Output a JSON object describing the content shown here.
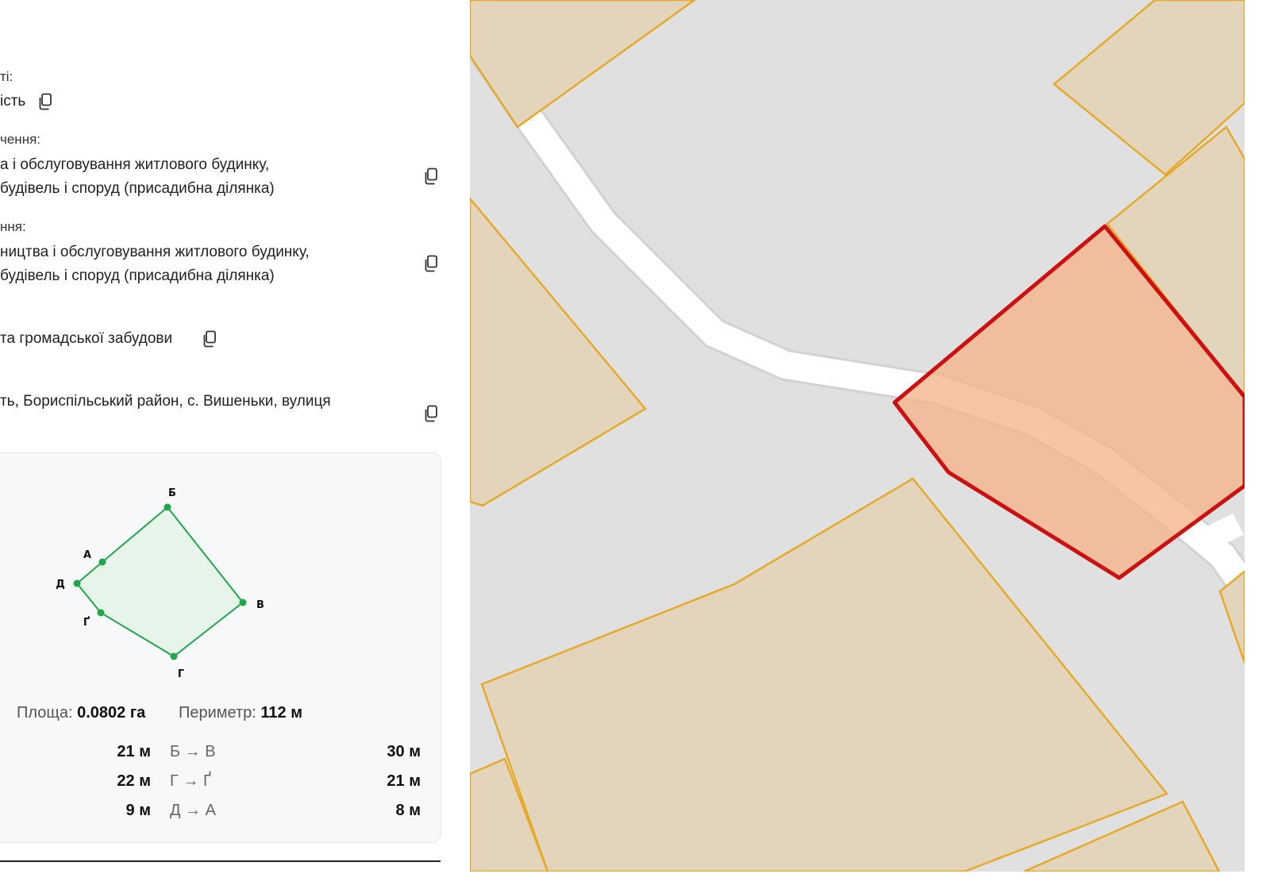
{
  "panel": {
    "ownership": {
      "label": "ті:",
      "value": "ість"
    },
    "purpose": {
      "label": "чення:",
      "line1": "а і обслуговування житлового будинку,",
      "line2": "будівель і споруд (присадибна ділянка)"
    },
    "usage": {
      "label": "ння:",
      "line1": "ництва і обслуговування житлового будинку,",
      "line2": "будівель і споруд (присадибна ділянка)"
    },
    "category": {
      "value": "та громадської забудови"
    },
    "address": {
      "line1": "ть, Бориспільський район, с. Вишеньки, вулиця"
    }
  },
  "shape_card": {
    "vertices": [
      "Б",
      "А",
      "Д",
      "В",
      "Ґ",
      "Г"
    ],
    "area_label": "Площа:",
    "area_value": "0.0802 га",
    "perimeter_label": "Периметр:",
    "perimeter_value": "112 м",
    "rows": [
      {
        "left_dist": "21 м",
        "segment": "Б → В",
        "right_dist": "30 м"
      },
      {
        "left_dist": "22 м",
        "segment": "Г → Ґ",
        "right_dist": "21 м"
      },
      {
        "left_dist": "9 м",
        "segment": "Д → А",
        "right_dist": "8 м"
      }
    ]
  },
  "colors": {
    "parcel_fill": "#e2d5bc",
    "parcel_stroke": "#e6a92a",
    "road": "#ffffff",
    "background": "#e0e0e0",
    "selected_fill": "#f5b58a",
    "selected_stroke": "#cc1111",
    "shape_fill": "#e6f4ea",
    "shape_stroke": "#22a64a"
  }
}
